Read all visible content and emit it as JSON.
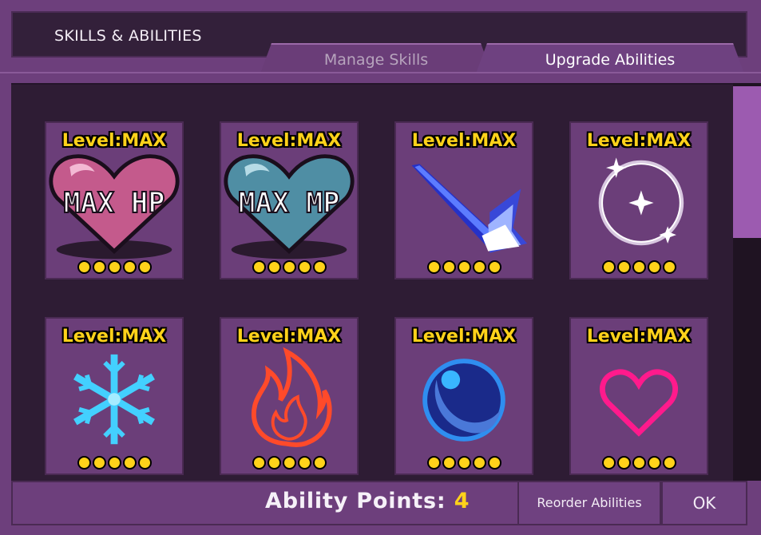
{
  "window": {
    "title": "SKILLS & ABILITIES"
  },
  "tabs": [
    {
      "label": "Manage Skills",
      "active": false
    },
    {
      "label": "Upgrade Abilities",
      "active": true
    }
  ],
  "cards": [
    {
      "level": "Level:MAX",
      "icon": "max-hp-heart-icon",
      "icon_text": "MAX HP",
      "dots": 5
    },
    {
      "level": "Level:MAX",
      "icon": "max-mp-heart-icon",
      "icon_text": "MAX MP",
      "dots": 5
    },
    {
      "level": "Level:MAX",
      "icon": "dash-strike-icon",
      "dots": 5
    },
    {
      "level": "Level:MAX",
      "icon": "sparkle-ring-icon",
      "dots": 5
    },
    {
      "level": "Level:MAX",
      "icon": "snowflake-icon",
      "dots": 5
    },
    {
      "level": "Level:MAX",
      "icon": "fire-icon",
      "dots": 5
    },
    {
      "level": "Level:MAX",
      "icon": "water-orb-icon",
      "dots": 5
    },
    {
      "level": "Level:MAX",
      "icon": "heart-outline-icon",
      "dots": 5
    }
  ],
  "footer": {
    "ability_points_label": "Ability Points:",
    "ability_points_value": "4",
    "reorder_label": "Reorder Abilities",
    "ok_label": "OK"
  },
  "colors": {
    "level_text": "#ffd21a",
    "panel": "#6d3f7c",
    "grid_bg": "#2e1c34",
    "scroll_thumb": "#9c5bb0"
  }
}
